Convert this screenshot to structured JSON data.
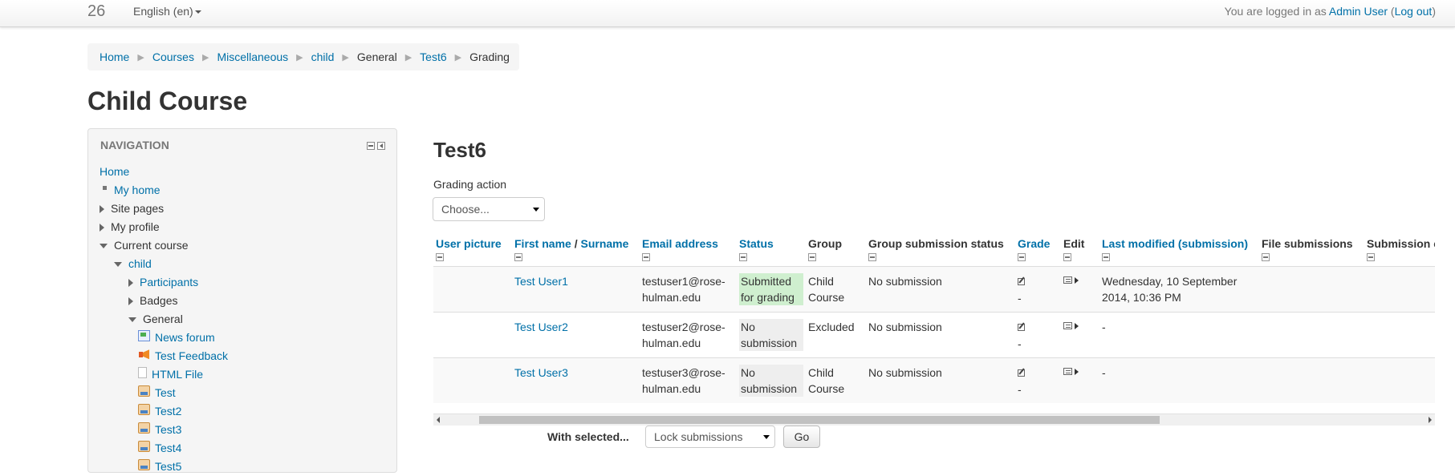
{
  "navbar": {
    "brand": "26",
    "language": "English (en)",
    "login_prefix": "You are logged in as ",
    "user": "Admin User",
    "logout": "Log out"
  },
  "breadcrumb": [
    "Home",
    "Courses",
    "Miscellaneous",
    "child",
    "General",
    "Test6",
    "Grading"
  ],
  "course_title": "Child Course",
  "navigation": {
    "title": "NAVIGATION",
    "home": "Home",
    "my_home": "My home",
    "site_pages": "Site pages",
    "my_profile": "My profile",
    "current_course": "Current course",
    "child": "child",
    "participants": "Participants",
    "badges": "Badges",
    "general": "General",
    "activities": [
      "News forum",
      "Test Feedback",
      "HTML File",
      "Test",
      "Test2",
      "Test3",
      "Test4",
      "Test5"
    ]
  },
  "main": {
    "title": "Test6",
    "grading_action_label": "Grading action",
    "grading_action_value": "Choose...",
    "with_selected": "With selected...",
    "bulk_action_value": "Lock submissions",
    "go": "Go"
  },
  "table": {
    "headers": {
      "user_picture": "User picture",
      "first_name": "First name",
      "slash": " / ",
      "surname": "Surname",
      "email": "Email address",
      "status": "Status",
      "group": "Group",
      "group_status": "Group submission status",
      "grade": "Grade",
      "edit": "Edit",
      "last_modified": "Last modified (submission)",
      "file_submissions": "File submissions",
      "submission_comments": "Submission comments"
    },
    "rows": [
      {
        "name": "Test User1",
        "email": "testuser1@rose-hulman.edu",
        "status": "Submitted for grading",
        "group": "Child Course",
        "group_status": "No submission",
        "grade": "-",
        "last_modified": "Wednesday, 10 September 2014, 10:36 PM"
      },
      {
        "name": "Test User2",
        "email": "testuser2@rose-hulman.edu",
        "status": "No submission",
        "group": "Excluded",
        "group_status": "No submission",
        "grade": "-",
        "last_modified": "-"
      },
      {
        "name": "Test User3",
        "email": "testuser3@rose-hulman.edu",
        "status": "No submission",
        "group": "Child Course",
        "group_status": "No submission",
        "grade": "-",
        "last_modified": "-"
      }
    ]
  }
}
